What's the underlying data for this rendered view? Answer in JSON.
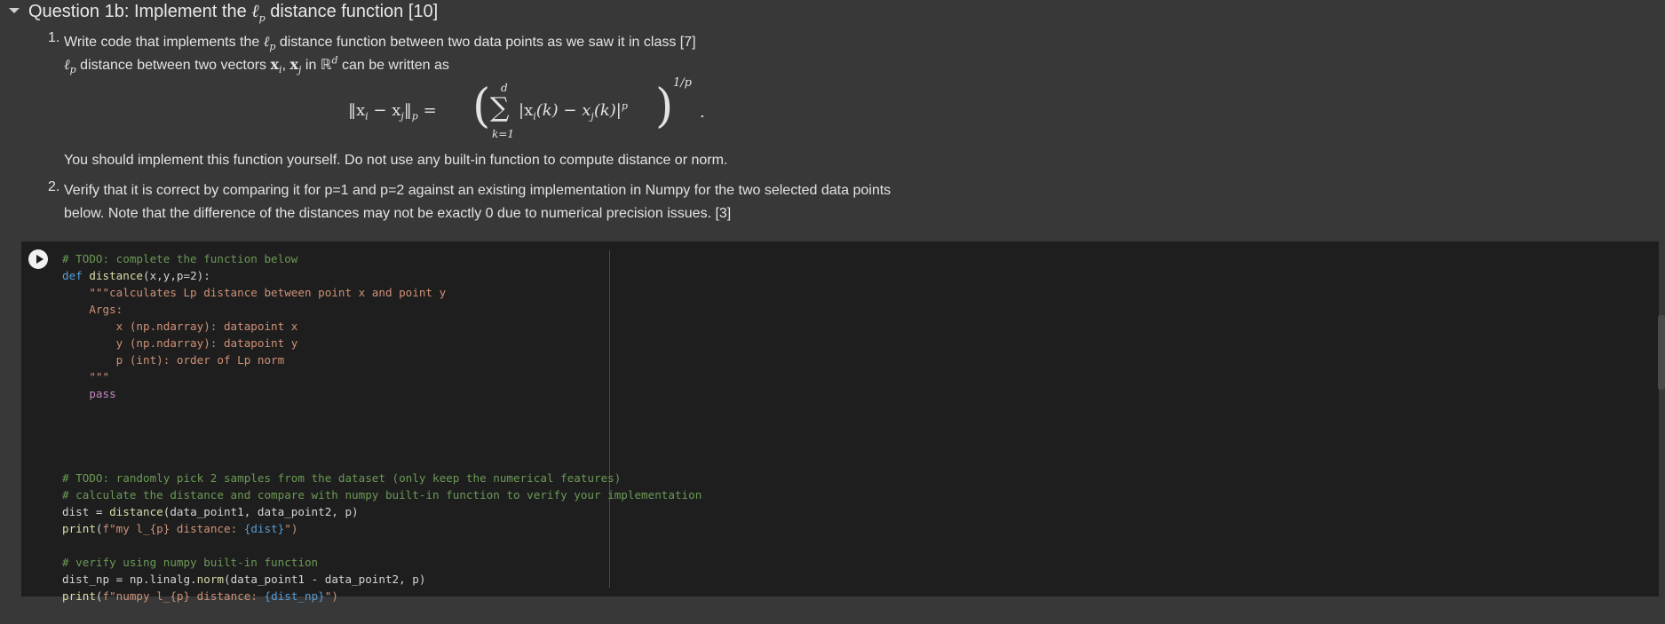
{
  "heading": {
    "prefix": "Question 1b: Implement the ",
    "symbol": "ℓ",
    "subscript": "p",
    "suffix": " distance function [10]"
  },
  "instructions": {
    "item1_num": "1.",
    "item1_text": "Write code that implements the ",
    "item1_symbol": "ℓ",
    "item1_sub": "p",
    "item1_tail": " distance function between two data points as we saw it in class [7]",
    "def_symbol": "ℓ",
    "def_sub": "p",
    "def_text": " distance between two vectors ",
    "def_vec_xi": "x",
    "def_sub_i": "i",
    "def_comma": ", ",
    "def_vec_xj": "x",
    "def_sub_j": "j",
    "def_in": " in ",
    "def_R": "ℝ",
    "def_sup_d": "d",
    "def_tail": " can be written as",
    "formula_lhs": "‖x",
    "formula_lhs_i": "i",
    "formula_lhs_minus": " − x",
    "formula_lhs_j": "j",
    "formula_lhs_close": "‖",
    "formula_lhs_p": "p",
    "formula_eq": " =",
    "formula_lparen": "(",
    "formula_sigma": "∑",
    "formula_sum_upper": "d",
    "formula_sum_lower": "k=1",
    "formula_body": "|x",
    "formula_body_i": "i",
    "formula_body_mid": "(k) − x",
    "formula_body_j": "j",
    "formula_body_end": "(k)|",
    "formula_body_p": "p",
    "formula_rparen": ")",
    "formula_exp": "1/p",
    "formula_dot": ".",
    "note": "You should implement this function yourself. Do not use any built-in function to compute distance or norm.",
    "item2_num": "2.",
    "item2_line1": "Verify that it is correct by comparing it for p=1 and p=2 against an existing implementation in Numpy for the two selected data points",
    "item2_line2": "below. Note that the difference of the distances may not be exactly 0 due to numerical precision issues. [3]"
  },
  "code": {
    "l1": "# TODO: complete the function below",
    "l2_kw": "def",
    "l2_sp": " ",
    "l2_fn": "distance",
    "l2_args": "(x,y,p=2):",
    "l3": "    \"\"\"calculates Lp distance between point x and point y",
    "l4": "    Args:",
    "l5": "        x (np.ndarray): datapoint x",
    "l6": "        y (np.ndarray): datapoint y",
    "l7": "        p (int): order of Lp norm",
    "l8": "    \"\"\"",
    "l9": "    pass",
    "l14": "# TODO: randomly pick 2 samples from the dataset (only keep the numerical features)",
    "l15": "# calculate the distance and compare with numpy built-in function to verify your implementation",
    "l16_a": "dist = ",
    "l16_fn": "distance",
    "l16_b": "(data_point1, data_point2, p)",
    "l17_fn": "print",
    "l17_a": "(",
    "l17_str": "f\"my l_{p} distance: ",
    "l17_var": "{dist}",
    "l17_end": "\")",
    "l19": "# verify using numpy built-in function",
    "l20_a": "dist_np = np.linalg.",
    "l20_fn": "norm",
    "l20_b": "(data_point1 - data_point2, p)",
    "l21_fn": "print",
    "l21_a": "(",
    "l21_str": "f\"numpy l_{p} distance: ",
    "l21_var": "{dist_np}",
    "l21_end": "\")"
  },
  "colors": {
    "background": "#383838",
    "code_background": "#1e1e1e",
    "comment": "#6a9955",
    "keyword": "#569cd6",
    "function": "#dcdcaa",
    "string": "#ce9178"
  },
  "icons": {
    "collapse": "caret-down-icon",
    "run": "play-icon"
  }
}
